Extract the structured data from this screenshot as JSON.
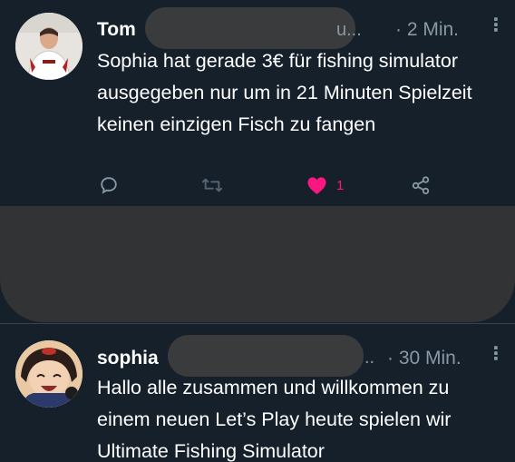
{
  "tweets": [
    {
      "author_name": "Tom",
      "handle_tail": "u...",
      "time": "· 2 Min.",
      "text": "Sophia hat gerade 3€ für fishing simulator ausgegeben nur um in 21 Minuten Spielzeit keinen einzigen Fisch zu fangen",
      "likes": "1",
      "liked": true,
      "actions": {
        "reply_icon": "reply-icon",
        "retweet_icon": "retweet-icon",
        "like_icon": "heart-icon",
        "share_icon": "share-icon"
      }
    },
    {
      "author_name": "sophia",
      "handle_tail": "..",
      "time": "· 30 Min.",
      "text": "Hallo alle zusammen und willkommen zu einem neuen Let’s Play heute spielen wir Ultimate Fishing Simulator"
    }
  ],
  "colors": {
    "background": "#15202b",
    "muted_text": "#8899a6",
    "like_pink": "#f91880",
    "redaction": "#3a3b3c"
  }
}
